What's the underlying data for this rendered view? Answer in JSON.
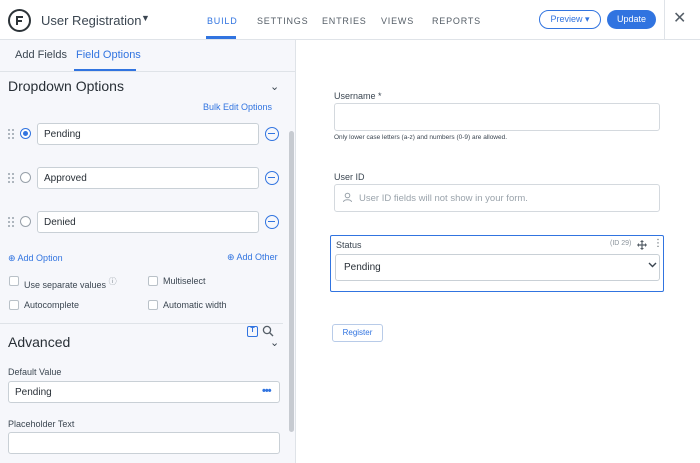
{
  "header": {
    "form_title": "User Registration",
    "tabs": [
      "BUILD",
      "SETTINGS",
      "ENTRIES",
      "VIEWS",
      "REPORTS"
    ],
    "active_tab": "BUILD",
    "preview_label": "Preview ▾",
    "update_label": "Update",
    "close_glyph": "✕",
    "accent_color": "#3174e0"
  },
  "left_panel": {
    "tabs": [
      "Add Fields",
      "Field Options"
    ],
    "active_tab": "Field Options",
    "dropdown_section": {
      "title": "Dropdown Options",
      "bulk_edit": "Bulk Edit Options",
      "options": [
        {
          "value": "Pending",
          "selected": true
        },
        {
          "value": "Approved",
          "selected": false
        },
        {
          "value": "Denied",
          "selected": false
        }
      ],
      "add_option": "⊕ Add Option",
      "add_other": "⊕ Add Other",
      "checkboxes": [
        "Use separate values",
        "Multiselect",
        "Autocomplete",
        "Automatic width"
      ]
    },
    "advanced_section": {
      "title": "Advanced",
      "default_value_label": "Default Value",
      "default_value": "Pending",
      "placeholder_label": "Placeholder Text",
      "placeholder_value": ""
    }
  },
  "canvas": {
    "username_label": "Username",
    "required_mark": "*",
    "username_hint": "Only lower case letters (a-z) and numbers (0-9) are allowed.",
    "userid_label": "User ID",
    "userid_placeholder": "User ID fields will not show in your form.",
    "status_label": "Status",
    "status_id": "(ID 29)",
    "status_value": "Pending",
    "register_label": "Register"
  }
}
